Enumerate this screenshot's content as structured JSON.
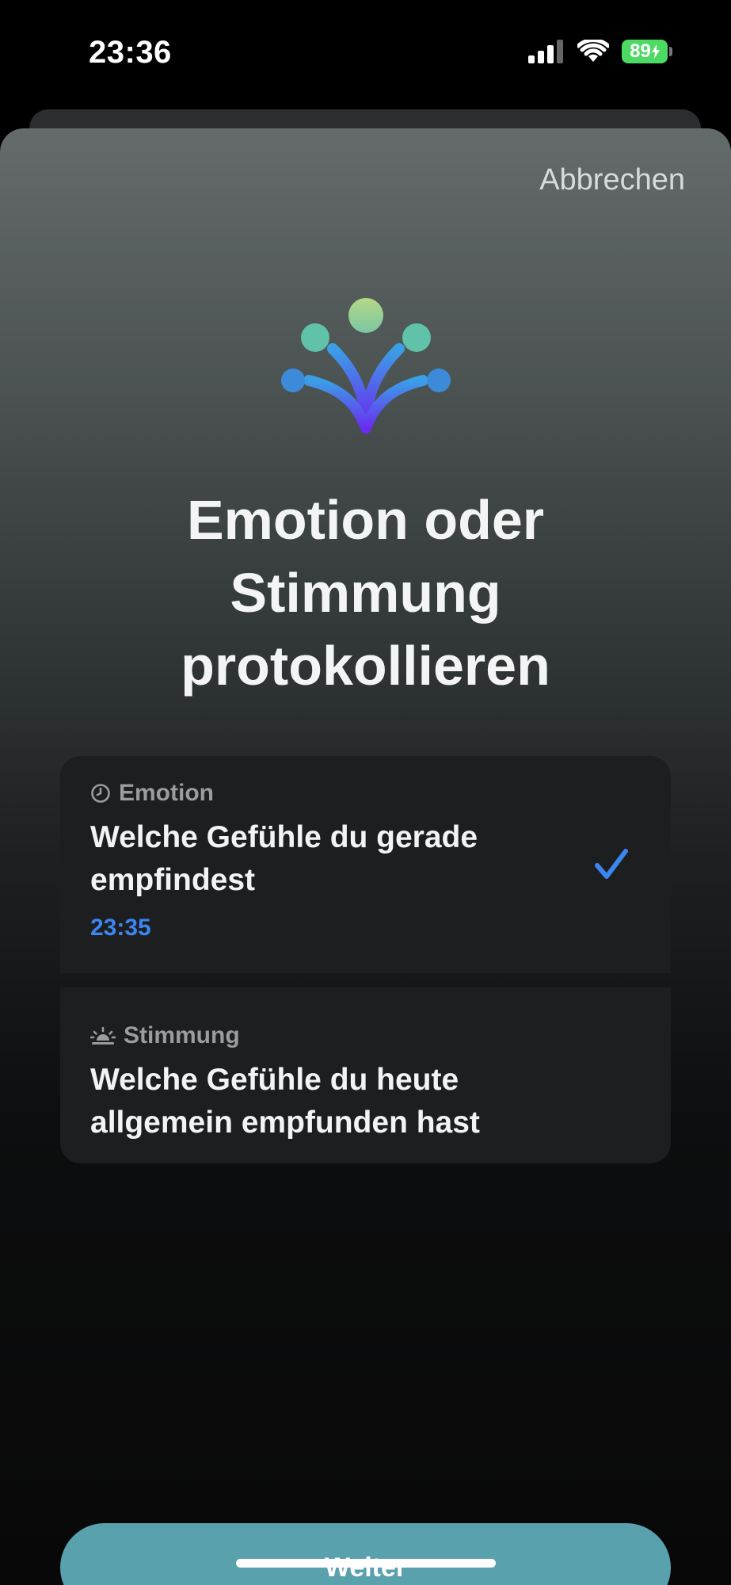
{
  "status_bar": {
    "time": "23:36",
    "battery_percent": "89",
    "icons": [
      "cellular-signal-icon",
      "wifi-icon",
      "battery-charging-icon"
    ]
  },
  "sheet": {
    "cancel_label": "Abbrechen",
    "logo_icon": "state-of-mind-icon",
    "title_lines": [
      "Emotion oder",
      "Stimmung",
      "protokollieren"
    ]
  },
  "options": [
    {
      "kicker": "Emotion",
      "kicker_icon": "clock-icon",
      "text": "Welche Gefühle du gerade empfindest",
      "time": "23:35",
      "selected": true
    },
    {
      "kicker": "Stimmung",
      "kicker_icon": "sunrise-icon",
      "text": "Welche Gefühle du heute allgemein empfunden hast",
      "selected": false
    }
  ],
  "footer": {
    "continue_label": "Weiter"
  },
  "colors": {
    "accent_blue": "#3b86f0",
    "button_teal": "#5aa1ae",
    "card_bg": "#1d1e20",
    "battery_green": "#4cd964"
  }
}
